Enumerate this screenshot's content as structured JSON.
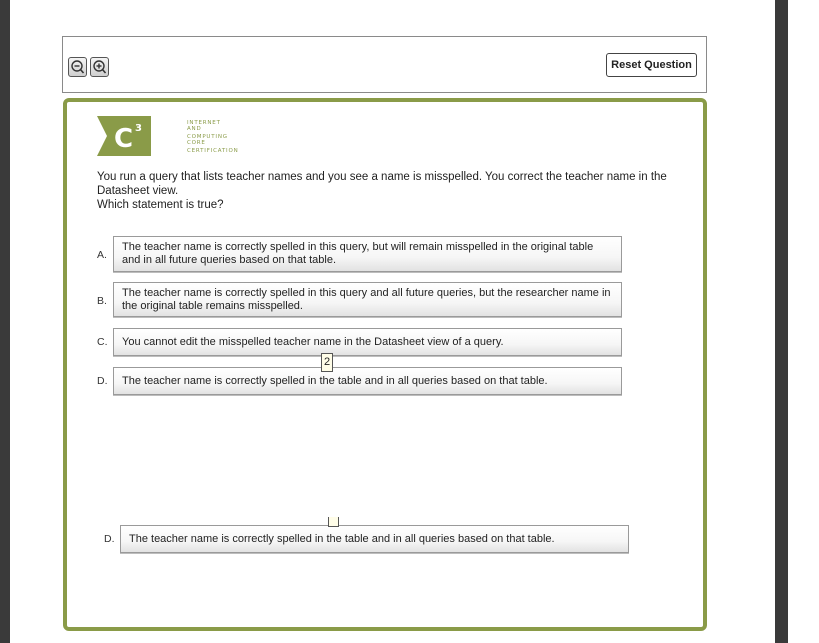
{
  "toolbar": {
    "reset_label": "Reset Question"
  },
  "logo": {
    "mark": "IC³",
    "line1": "INTERNET AND",
    "line2": "COMPUTING CORE",
    "line3": "CERTIFICATION"
  },
  "question": {
    "line1": "You run a query that lists teacher names and you see a name is misspelled. You correct the teacher name in the Datasheet view.",
    "line2": "Which statement is true?"
  },
  "options": [
    {
      "letter": "A.",
      "text": "The teacher name is correctly spelled in this query, but will remain misspelled in the original table and in all future queries based on that table."
    },
    {
      "letter": "B.",
      "text": "The teacher name is correctly spelled in this query and all future queries, but the researcher name in the original table remains misspelled."
    },
    {
      "letter": "C.",
      "text": "You cannot edit the misspelled teacher name in the Datasheet view of a query."
    },
    {
      "letter": "D.",
      "text": "The teacher name is correctly spelled in the table and in all queries based on that table."
    }
  ],
  "drag_copy": {
    "letter": "D.",
    "text": "The teacher name is correctly spelled in the table and in all queries based on that table."
  },
  "drag_tag": "2"
}
